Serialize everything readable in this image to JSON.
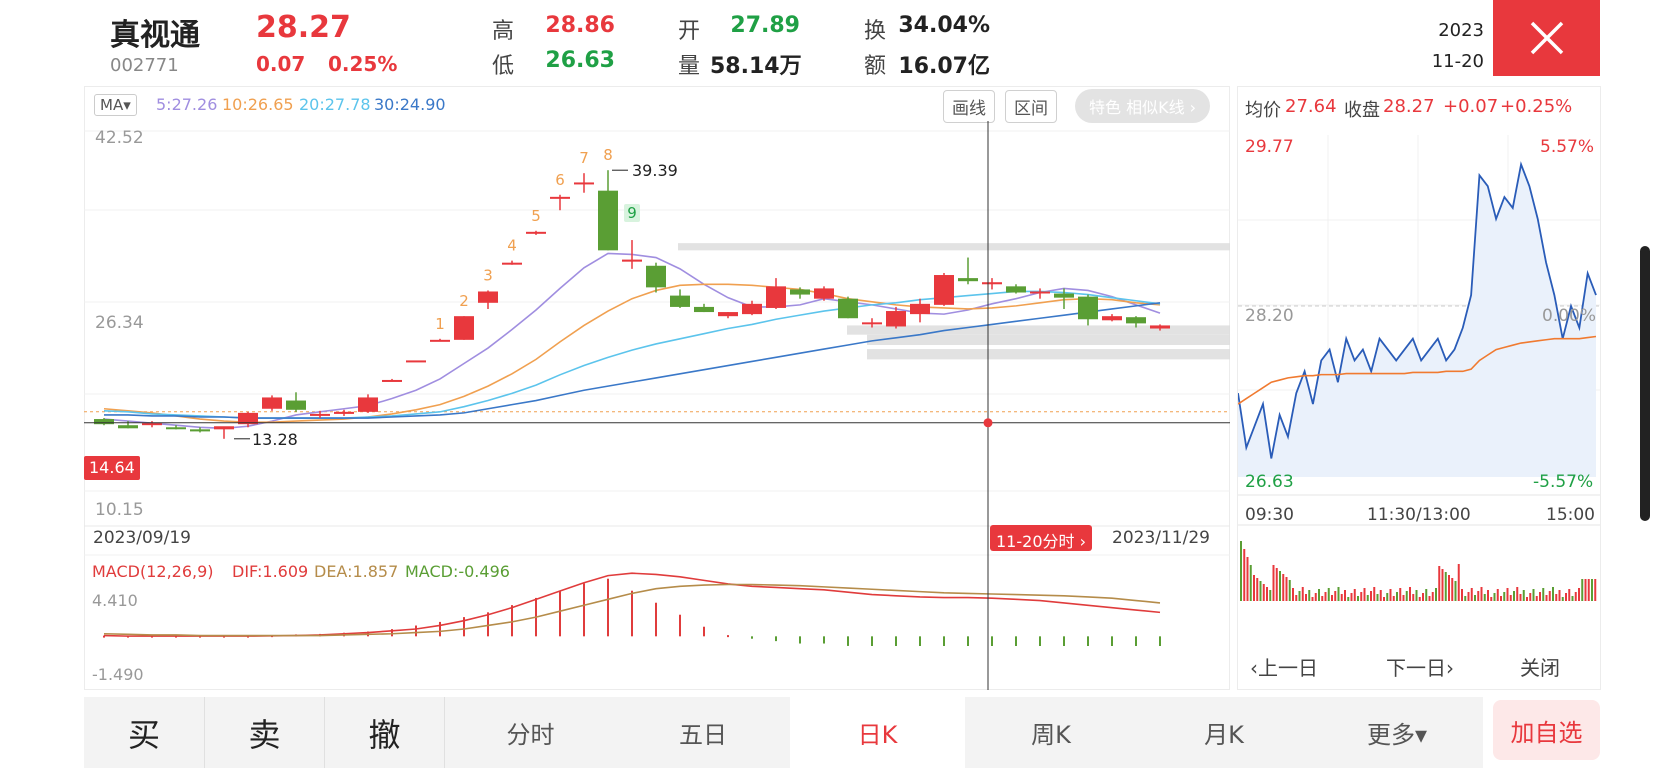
{
  "header": {
    "name": "真视通",
    "code": "002771",
    "price": "28.27",
    "change": "0.07",
    "change_pct": "0.25%",
    "high_label": "高",
    "high": "28.86",
    "low_label": "低",
    "low": "26.63",
    "open_label": "开",
    "open": "27.89",
    "volume_label": "量",
    "volume": "58.14万",
    "turnover_label": "换",
    "turnover": "34.04%",
    "amount_label": "额",
    "amount": "16.07亿",
    "date_year": "2023",
    "date_md": "11-20"
  },
  "colors": {
    "up": "#e8383d",
    "down": "#5a9e34",
    "ma5": "#a08ee0",
    "ma10": "#f0a050",
    "ma20": "#5cc4ec",
    "ma30": "#3a78c8",
    "dif": "#e03c3c",
    "dea": "#b58c4a"
  },
  "kline_toolbar": {
    "ma_selector": "MA▾",
    "ma5": "5:27.26",
    "ma10": "10:26.65",
    "ma20": "20:27.78",
    "ma30": "30:24.90",
    "draw_button": "画线",
    "range_button": "区间",
    "feature_pill": "特色  相似K线 ›"
  },
  "kline_axis": {
    "y_top": "42.52",
    "y_mid": "26.34",
    "y_bottom": "10.15",
    "crosshair_price": "14.64",
    "high_marker": "39.39",
    "low_marker": "13.28",
    "date_start": "2023/09/19",
    "date_end": "2023/11/29",
    "crosshair_date": "11-20分时 ›"
  },
  "macd": {
    "title": "MACD(12,26,9)",
    "dif": "DIF:1.609",
    "dea": "DEA:1.857",
    "macd": "MACD:-0.496",
    "y_top": "4.410",
    "y_bottom": "-1.490"
  },
  "chart_data": {
    "type": "candlestick",
    "dates_range": [
      "2023/09/19",
      "2023/11/29"
    ],
    "ylim": [
      10.15,
      42.52
    ],
    "candles": [
      {
        "o": 15.2,
        "h": 15.3,
        "l": 14.6,
        "c": 14.7
      },
      {
        "o": 14.6,
        "h": 15.0,
        "l": 14.3,
        "c": 14.3
      },
      {
        "o": 14.7,
        "h": 15.0,
        "l": 14.4,
        "c": 14.8
      },
      {
        "o": 14.4,
        "h": 14.6,
        "l": 14.2,
        "c": 14.3
      },
      {
        "o": 14.2,
        "h": 14.4,
        "l": 13.9,
        "c": 14.0
      },
      {
        "o": 14.2,
        "h": 14.4,
        "l": 13.28,
        "c": 14.5
      },
      {
        "o": 14.7,
        "h": 15.9,
        "l": 14.4,
        "c": 15.8
      },
      {
        "o": 16.2,
        "h": 17.5,
        "l": 16.0,
        "c": 17.3
      },
      {
        "o": 17.0,
        "h": 17.8,
        "l": 15.9,
        "c": 16.1
      },
      {
        "o": 15.6,
        "h": 16.0,
        "l": 15.3,
        "c": 15.7
      },
      {
        "o": 15.7,
        "h": 16.1,
        "l": 15.5,
        "c": 15.9
      },
      {
        "o": 15.9,
        "h": 17.6,
        "l": 15.8,
        "c": 17.3
      },
      {
        "o": 19.0,
        "h": 19.1,
        "l": 18.9,
        "c": 19.0
      },
      {
        "o": 20.9,
        "h": 20.9,
        "l": 20.9,
        "c": 20.9
      },
      {
        "o": 22.9,
        "h": 23.0,
        "l": 22.8,
        "c": 22.9
      },
      {
        "o": 22.9,
        "h": 25.2,
        "l": 22.9,
        "c": 25.2
      },
      {
        "o": 26.5,
        "h": 27.7,
        "l": 25.9,
        "c": 27.6
      },
      {
        "o": 30.4,
        "h": 30.6,
        "l": 30.2,
        "c": 30.4
      },
      {
        "o": 33.4,
        "h": 33.5,
        "l": 33.1,
        "c": 33.4
      },
      {
        "o": 36.8,
        "h": 37.0,
        "l": 35.5,
        "c": 36.8
      },
      {
        "o": 38.2,
        "h": 39.1,
        "l": 37.2,
        "c": 38.2
      },
      {
        "o": 37.4,
        "h": 39.39,
        "l": 31.6,
        "c": 31.6
      },
      {
        "o": 30.5,
        "h": 32.6,
        "l": 29.8,
        "c": 30.7
      },
      {
        "o": 30.1,
        "h": 30.4,
        "l": 27.5,
        "c": 28.0
      },
      {
        "o": 27.2,
        "h": 27.8,
        "l": 26.0,
        "c": 26.1
      },
      {
        "o": 26.1,
        "h": 26.4,
        "l": 25.6,
        "c": 25.6
      },
      {
        "o": 25.2,
        "h": 25.6,
        "l": 25.0,
        "c": 25.6
      },
      {
        "o": 25.4,
        "h": 26.7,
        "l": 25.3,
        "c": 26.4
      },
      {
        "o": 26.0,
        "h": 28.9,
        "l": 25.9,
        "c": 28.1
      },
      {
        "o": 27.8,
        "h": 28.0,
        "l": 26.9,
        "c": 27.3
      },
      {
        "o": 26.9,
        "h": 28.1,
        "l": 26.7,
        "c": 27.9
      },
      {
        "o": 26.9,
        "h": 27.1,
        "l": 25.0,
        "c": 25.0
      },
      {
        "o": 24.5,
        "h": 25.0,
        "l": 24.1,
        "c": 24.6
      },
      {
        "o": 24.2,
        "h": 26.1,
        "l": 24.0,
        "c": 25.7
      },
      {
        "o": 25.4,
        "h": 26.9,
        "l": 24.6,
        "c": 26.4
      },
      {
        "o": 26.3,
        "h": 29.4,
        "l": 26.2,
        "c": 29.2
      },
      {
        "o": 28.9,
        "h": 30.9,
        "l": 28.3,
        "c": 28.6
      },
      {
        "o": 28.3,
        "h": 28.9,
        "l": 27.8,
        "c": 28.5
      },
      {
        "o": 28.1,
        "h": 28.3,
        "l": 27.4,
        "c": 27.5
      },
      {
        "o": 27.5,
        "h": 27.9,
        "l": 26.9,
        "c": 27.6
      },
      {
        "o": 27.4,
        "h": 27.9,
        "l": 25.9,
        "c": 27.0
      },
      {
        "o": 27.1,
        "h": 27.3,
        "l": 24.3,
        "c": 24.9
      },
      {
        "o": 24.8,
        "h": 25.4,
        "l": 24.7,
        "c": 25.2
      },
      {
        "o": 25.1,
        "h": 25.2,
        "l": 24.1,
        "c": 24.5
      },
      {
        "o": 24.0,
        "h": 24.4,
        "l": 23.8,
        "c": 24.3
      }
    ],
    "rise_labels": [
      "1",
      "2",
      "3",
      "4",
      "5",
      "6",
      "7",
      "8",
      "9"
    ],
    "ma_values": {
      "ma5": [
        15.2,
        15.0,
        14.8,
        14.6,
        14.4,
        14.3,
        14.5,
        15.0,
        15.6,
        15.9,
        16.2,
        16.5,
        17.2,
        18.0,
        19.1,
        20.6,
        22.1,
        23.9,
        25.8,
        27.9,
        29.9,
        31.3,
        31.2,
        30.9,
        29.8,
        28.3,
        27.0,
        26.1,
        26.1,
        26.3,
        26.9,
        26.6,
        26.3,
        25.9,
        25.5,
        25.4,
        25.8,
        26.4,
        26.9,
        27.5,
        27.9,
        27.7,
        27.1,
        26.3,
        25.5
      ],
      "ma10": [
        16.2,
        16.0,
        15.8,
        15.5,
        15.2,
        15.0,
        14.9,
        14.9,
        15.0,
        15.1,
        15.2,
        15.4,
        15.7,
        16.1,
        16.6,
        17.4,
        18.4,
        19.6,
        21.0,
        22.7,
        24.3,
        25.7,
        26.9,
        27.7,
        28.2,
        28.3,
        28.3,
        28.2,
        28.0,
        27.8,
        27.4,
        26.9,
        26.6,
        26.3,
        26.1,
        26.0,
        25.9,
        26.0,
        26.2,
        26.5,
        26.8,
        26.9,
        26.8,
        26.5,
        26.3
      ],
      "ma20": [
        16.0,
        15.9,
        15.7,
        15.6,
        15.5,
        15.4,
        15.3,
        15.3,
        15.3,
        15.3,
        15.3,
        15.4,
        15.5,
        15.7,
        15.9,
        16.4,
        17.0,
        17.7,
        18.5,
        19.5,
        20.4,
        21.2,
        21.9,
        22.5,
        23.0,
        23.5,
        24.0,
        24.4,
        24.9,
        25.3,
        25.7,
        26.0,
        26.3,
        26.5,
        26.8,
        27.0,
        27.2,
        27.4,
        27.6,
        27.6,
        27.5,
        27.3,
        27.0,
        26.7,
        26.4
      ],
      "ma30": [
        15.6,
        15.6,
        15.5,
        15.5,
        15.4,
        15.4,
        15.3,
        15.3,
        15.3,
        15.3,
        15.3,
        15.3,
        15.4,
        15.5,
        15.6,
        15.8,
        16.2,
        16.6,
        17.0,
        17.5,
        18.0,
        18.4,
        18.8,
        19.2,
        19.6,
        20.0,
        20.4,
        20.8,
        21.2,
        21.6,
        22.0,
        22.4,
        22.8,
        23.1,
        23.4,
        23.8,
        24.1,
        24.4,
        24.7,
        25.0,
        25.3,
        25.6,
        25.9,
        26.2,
        26.5
      ]
    },
    "macd_series": {
      "ylim": [
        -1.49,
        4.41
      ],
      "dif": [
        -1.45,
        -1.5,
        -1.5,
        -1.5,
        -1.5,
        -1.5,
        -1.5,
        -1.48,
        -1.45,
        -1.4,
        -1.3,
        -1.2,
        -1.05,
        -0.9,
        -0.6,
        -0.2,
        0.3,
        0.9,
        1.6,
        2.3,
        3.0,
        3.6,
        3.8,
        3.7,
        3.5,
        3.2,
        2.9,
        2.7,
        2.6,
        2.5,
        2.4,
        2.2,
        2.0,
        1.9,
        1.8,
        1.75,
        1.75,
        1.7,
        1.6,
        1.5,
        1.3,
        1.1,
        0.9,
        0.7,
        0.5
      ],
      "dea": [
        -1.3,
        -1.35,
        -1.4,
        -1.4,
        -1.45,
        -1.45,
        -1.45,
        -1.45,
        -1.45,
        -1.45,
        -1.4,
        -1.35,
        -1.3,
        -1.2,
        -1.1,
        -0.9,
        -0.6,
        -0.3,
        0.1,
        0.6,
        1.1,
        1.6,
        2.1,
        2.5,
        2.7,
        2.8,
        2.85,
        2.85,
        2.8,
        2.75,
        2.65,
        2.55,
        2.45,
        2.35,
        2.25,
        2.15,
        2.1,
        2.05,
        2.0,
        1.95,
        1.9,
        1.8,
        1.7,
        1.5,
        1.3
      ],
      "hist": [
        0.03,
        0.03,
        0.03,
        0.03,
        0.03,
        0.03,
        0.03,
        0.05,
        0.08,
        0.1,
        0.15,
        0.2,
        0.3,
        0.45,
        0.6,
        0.8,
        1.0,
        1.3,
        1.6,
        1.9,
        2.2,
        2.4,
        1.9,
        1.4,
        0.9,
        0.4,
        0.05,
        -0.1,
        -0.2,
        -0.3,
        -0.3,
        -0.4,
        -0.45,
        -0.5,
        -0.5,
        -0.5,
        -0.45,
        -0.45,
        -0.45,
        -0.5,
        -0.55,
        -0.6,
        -0.6,
        -0.6,
        -0.6
      ]
    }
  },
  "intraday": {
    "avg_label": "均价",
    "avg": "27.64",
    "close_label": "收盘",
    "close": "28.27",
    "change": "+0.07",
    "change_pct": "+0.25%",
    "y_top": "29.77",
    "y_mid": "28.20",
    "y_bottom": "26.63",
    "pct_top": "5.57%",
    "pct_mid": "0.00%",
    "pct_bottom": "-5.57%",
    "t_start": "09:30",
    "t_mid": "11:30/13:00",
    "t_end": "15:00",
    "prev_day": "‹上一日",
    "next_day": "下一日›",
    "close_btn": "关闭",
    "price_line": [
      27.4,
      26.9,
      27.1,
      27.3,
      26.8,
      27.2,
      27.0,
      27.4,
      27.6,
      27.3,
      27.7,
      27.8,
      27.5,
      27.9,
      27.7,
      27.8,
      27.6,
      27.9,
      27.8,
      27.7,
      27.8,
      27.9,
      27.7,
      27.8,
      27.9,
      27.7,
      27.8,
      28.0,
      28.3,
      29.4,
      29.3,
      29.0,
      29.2,
      29.1,
      29.5,
      29.3,
      29.0,
      28.6,
      28.3,
      27.9,
      28.2,
      28.0,
      28.5,
      28.3
    ],
    "avg_line": [
      27.3,
      27.35,
      27.4,
      27.45,
      27.5,
      27.52,
      27.54,
      27.55,
      27.56,
      27.56,
      27.57,
      27.57,
      27.57,
      27.58,
      27.58,
      27.58,
      27.58,
      27.58,
      27.58,
      27.58,
      27.58,
      27.59,
      27.59,
      27.59,
      27.59,
      27.6,
      27.6,
      27.6,
      27.62,
      27.7,
      27.75,
      27.8,
      27.82,
      27.84,
      27.86,
      27.87,
      27.88,
      27.89,
      27.9,
      27.9,
      27.9,
      27.9,
      27.91,
      27.92
    ]
  },
  "bottom_bar": {
    "buy": "买",
    "sell": "卖",
    "cancel": "撤",
    "tab_intraday": "分时",
    "tab_five_day": "五日",
    "tab_daily": "日K",
    "tab_weekly": "周K",
    "tab_monthly": "月K",
    "tab_more": "更多▾",
    "add_watch": "加自选"
  }
}
